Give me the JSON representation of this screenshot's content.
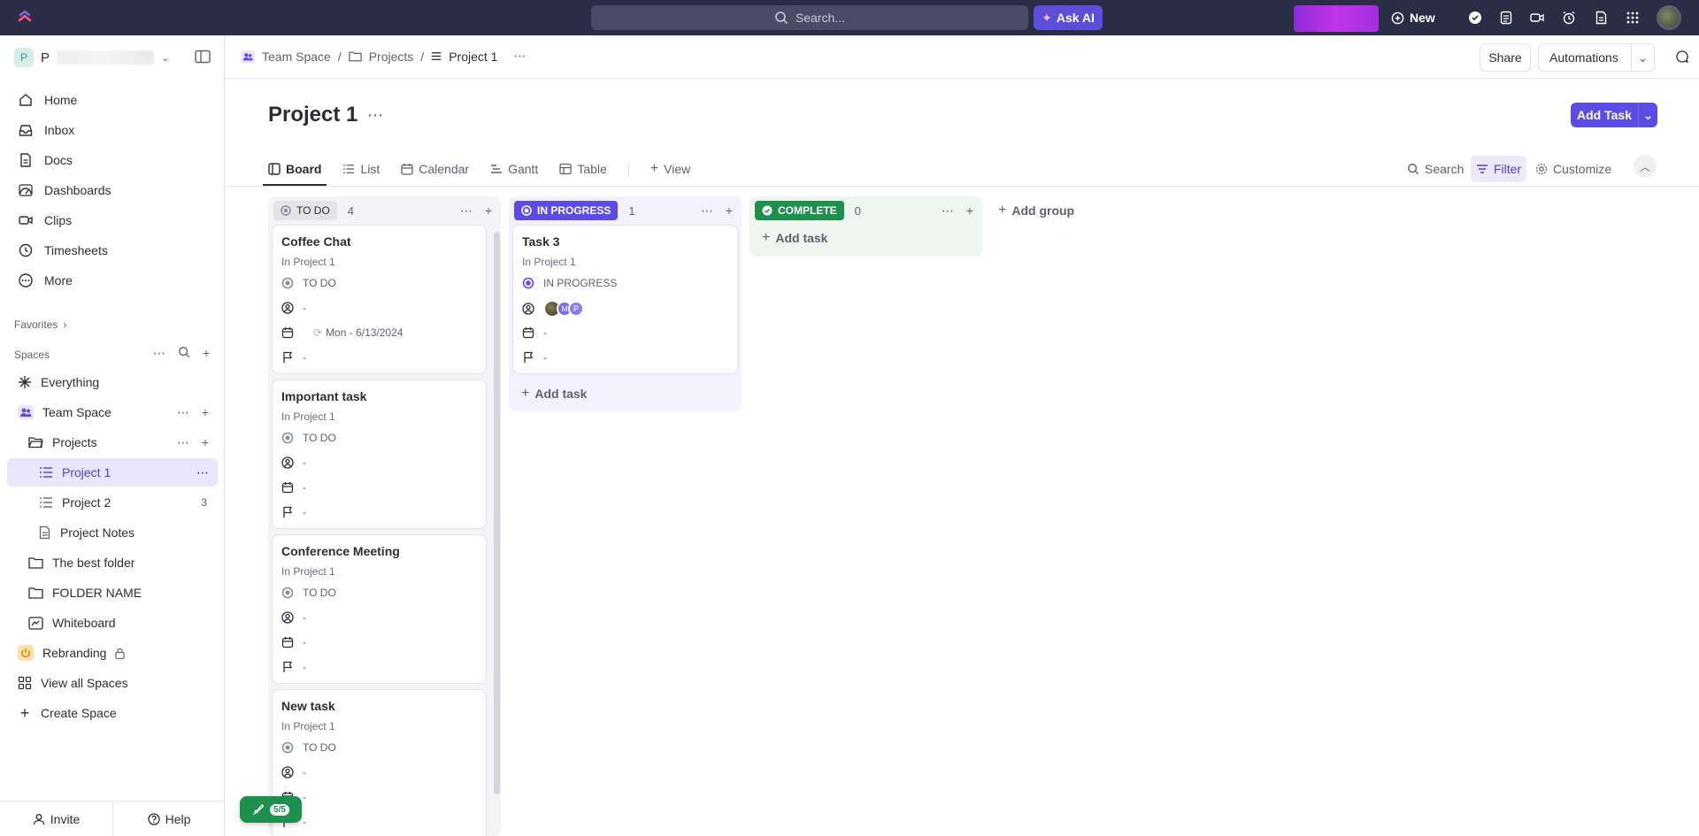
{
  "topbar": {
    "search_placeholder": "Search...",
    "ask_ai": "Ask AI",
    "new": "New"
  },
  "workspace": {
    "initial": "P",
    "name": "P"
  },
  "nav": [
    {
      "label": "Home",
      "icon": "home-icon"
    },
    {
      "label": "Inbox",
      "icon": "inbox-icon"
    },
    {
      "label": "Docs",
      "icon": "docs-icon"
    },
    {
      "label": "Dashboards",
      "icon": "dashboards-icon"
    },
    {
      "label": "Clips",
      "icon": "clips-icon"
    },
    {
      "label": "Timesheets",
      "icon": "timesheets-icon"
    },
    {
      "label": "More",
      "icon": "more-icon"
    }
  ],
  "favorites_label": "Favorites",
  "spaces_label": "Spaces",
  "tree": {
    "everything": "Everything",
    "team_space": "Team Space",
    "projects": "Projects",
    "project1": "Project 1",
    "project2": "Project 2",
    "project2_count": "3",
    "project_notes": "Project Notes",
    "best_folder": "The best folder",
    "folder_name": "FOLDER NAME",
    "whiteboard": "Whiteboard",
    "rebranding": "Rebranding",
    "view_all_spaces": "View all Spaces",
    "create_space": "Create Space"
  },
  "sidebar_bottom": {
    "invite": "Invite",
    "help": "Help"
  },
  "breadcrumb": {
    "space": "Team Space",
    "folder": "Projects",
    "list": "Project 1"
  },
  "header_buttons": {
    "share": "Share",
    "automations": "Automations"
  },
  "page": {
    "title": "Project 1",
    "add_task": "Add Task"
  },
  "tabs": [
    "Board",
    "List",
    "Calendar",
    "Gantt",
    "Table"
  ],
  "add_view": "View",
  "view_actions": {
    "search": "Search",
    "filter": "Filter",
    "customize": "Customize"
  },
  "columns": {
    "todo": {
      "label": "TO DO",
      "count": "4"
    },
    "inprog": {
      "label": "IN PROGRESS",
      "count": "1"
    },
    "complete": {
      "label": "COMPLETE",
      "count": "0"
    }
  },
  "cards": {
    "c1": {
      "title": "Coffee Chat",
      "loc": "In Project 1",
      "status": "TO DO",
      "assignee": "-",
      "date": "Mon - 6/13/2024",
      "priority": "-"
    },
    "c2": {
      "title": "Important task",
      "loc": "In Project 1",
      "status": "TO DO",
      "assignee": "-",
      "date": "-",
      "priority": "-"
    },
    "c3": {
      "title": "Conference Meeting",
      "loc": "In Project 1",
      "status": "TO DO",
      "assignee": "-",
      "date": "-",
      "priority": "-"
    },
    "c4": {
      "title": "New task",
      "loc": "In Project 1",
      "status": "TO DO",
      "assignee": "-",
      "date": "-",
      "priority": "-"
    },
    "c5": {
      "title": "Task 3",
      "loc": "In Project 1",
      "status": "IN PROGRESS",
      "date": "-",
      "priority": "-",
      "avatar_m": "M",
      "avatar_p": "P"
    }
  },
  "add_task_label": "Add task",
  "add_group": "Add group",
  "rocket_badge": "5/5",
  "colors": {
    "accent": "#5b4ce3",
    "complete": "#1f8f4e",
    "topbar": "#2b2c45"
  }
}
